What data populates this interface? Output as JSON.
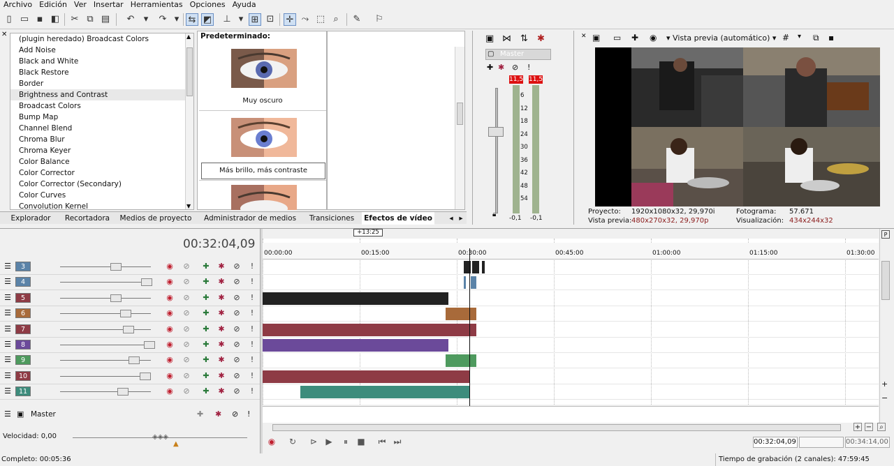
{
  "menu": [
    "Archivo",
    "Edición",
    "Ver",
    "Insertar",
    "Herramientas",
    "Opciones",
    "Ayuda"
  ],
  "fx_list": {
    "items": [
      "(plugin heredado) Broadcast Colors",
      "Add Noise",
      "Black and White",
      "Black Restore",
      "Border",
      "Brightness and Contrast",
      "Broadcast Colors",
      "Bump Map",
      "Channel Blend",
      "Chroma Blur",
      "Chroma Keyer",
      "Color Balance",
      "Color Corrector",
      "Color Corrector (Secondary)",
      "Color Curves",
      "Convolution Kernel"
    ],
    "selected_index": 5
  },
  "presets": {
    "header": "Predeterminado:",
    "items": [
      "Muy oscuro",
      "Más brillo, más contraste"
    ]
  },
  "dock_tabs": [
    "Explorador",
    "Recortadora",
    "Medios de proyecto",
    "Administrador de medios",
    "Transiciones",
    "Efectos de vídeo"
  ],
  "dock_active_tab": "Efectos de vídeo",
  "mixer": {
    "label": "Master",
    "peak_left": "11,5",
    "peak_right": "11,5",
    "scale": [
      "6",
      "12",
      "18",
      "24",
      "30",
      "36",
      "42",
      "48",
      "54"
    ],
    "bottom_left": "-0,1",
    "bottom_right": "-0,1"
  },
  "preview": {
    "mode": "Vista previa (automático)",
    "proyecto_label": "Proyecto:",
    "proyecto_value": "1920x1080x32, 29,970i",
    "vista_label": "Vista previa:",
    "vista_value": "480x270x32, 29,970p",
    "fotograma_label": "Fotograma:",
    "fotograma_value": "57.671",
    "visualizacion_label": "Visualización:",
    "visualizacion_value": "434x244x32"
  },
  "timeline": {
    "timecode": "00:32:04,09",
    "marker": "+13:25",
    "ruler_labels": [
      "00:00:00",
      "00:15:00",
      "00:30:00",
      "00:45:00",
      "01:00:00",
      "01:15:00",
      "01:30:00"
    ],
    "tracks": [
      {
        "num": "3",
        "color": "#5b83a8"
      },
      {
        "num": "4",
        "color": "#5b83a8"
      },
      {
        "num": "5",
        "color": "#8e3b45"
      },
      {
        "num": "6",
        "color": "#a86a3a"
      },
      {
        "num": "7",
        "color": "#8e3b45"
      },
      {
        "num": "8",
        "color": "#6b4a9a"
      },
      {
        "num": "9",
        "color": "#4e9a5e"
      },
      {
        "num": "10",
        "color": "#8e3b45"
      },
      {
        "num": "11",
        "color": "#3d8c7c"
      }
    ],
    "master_label": "Master"
  },
  "transport": {
    "time_current": "00:32:04,09",
    "time_total": "00:34:14,00"
  },
  "status": {
    "velocidad": "Velocidad: 0,00",
    "completo": "Completo: 00:05:36",
    "tiempo": "Tiempo de grabación (2 canales): 47:59:45"
  }
}
